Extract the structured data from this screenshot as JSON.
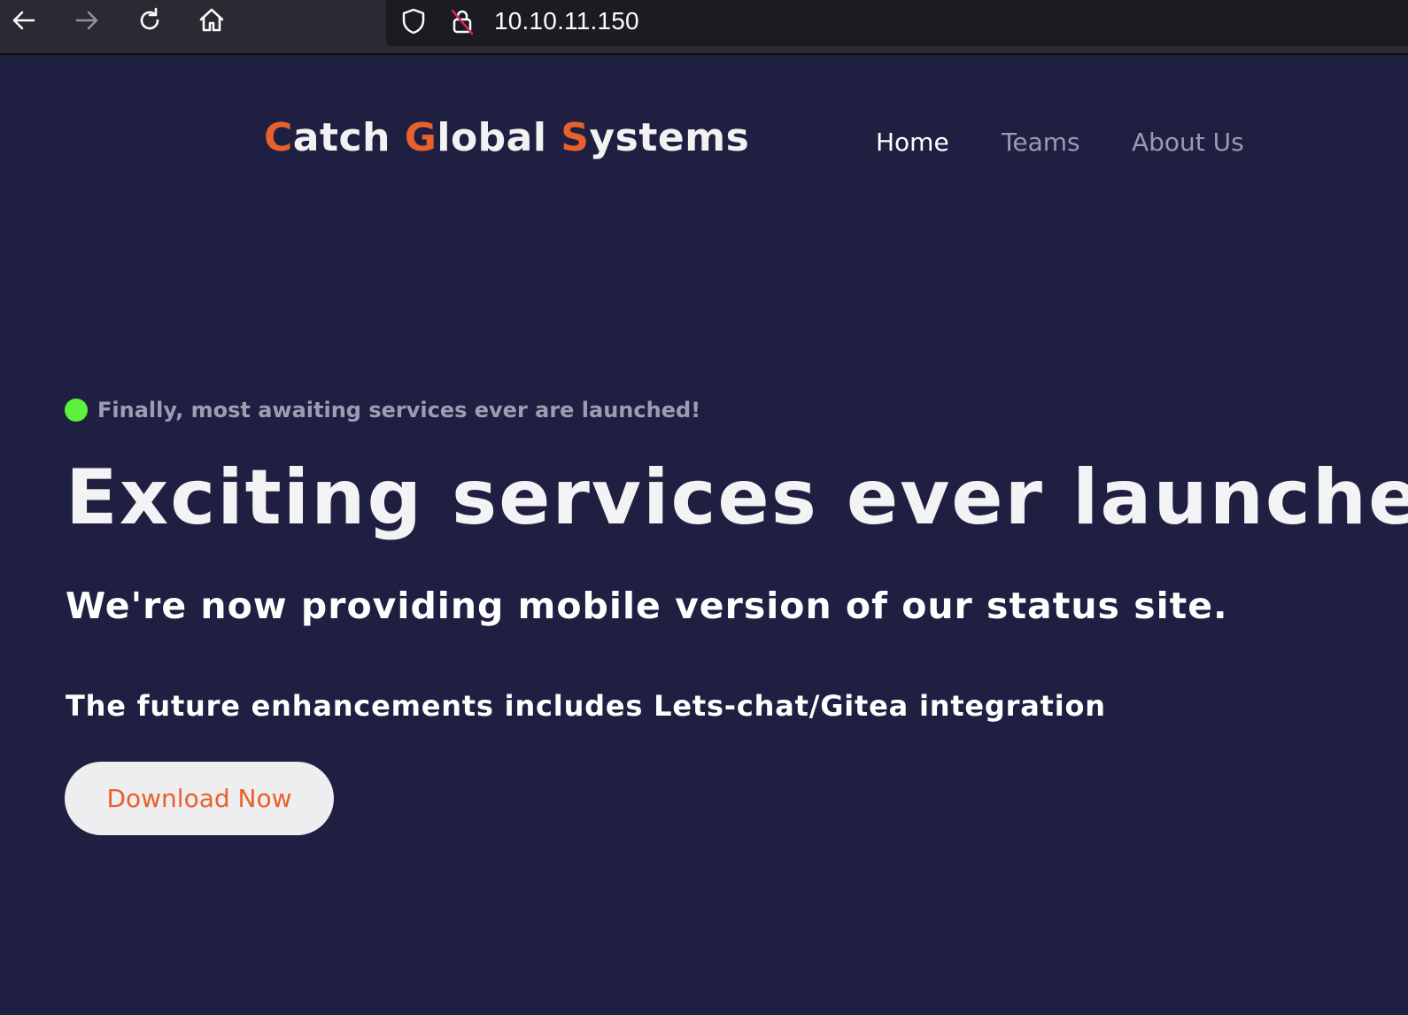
{
  "browser": {
    "url": "10.10.11.150",
    "icons": [
      "back-arrow-icon",
      "forward-arrow-icon",
      "reload-icon",
      "home-icon",
      "shield-icon",
      "insecure-lock-icon"
    ]
  },
  "site": {
    "brand": {
      "c1": "C",
      "w1": "atch ",
      "c2": "G",
      "w2": "lobal ",
      "c3": "S",
      "w3": "ystems"
    },
    "nav": [
      {
        "label": "Home"
      },
      {
        "label": "Teams"
      },
      {
        "label": "About Us"
      }
    ]
  },
  "hero": {
    "tagline": "Finally, most awaiting services ever are launched!",
    "title": "Exciting services ever launched by C",
    "subtitle": "We're now providing mobile version of our status site.",
    "note": "The future enhancements includes Lets-chat/Gitea integration",
    "cta_label": "Download Now"
  },
  "colors": {
    "page_background": "#1f2041",
    "brand_accent": "#e8602c",
    "status_dot": "#5cf23b",
    "toolbar": "#2b2a33"
  }
}
